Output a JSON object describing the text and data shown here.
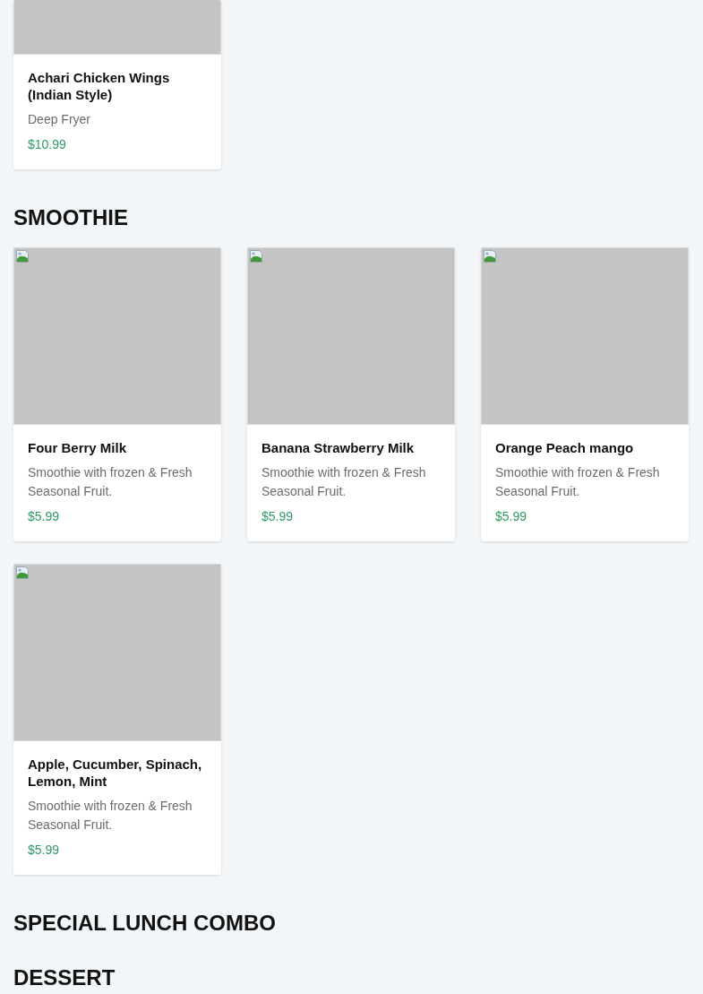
{
  "sections": [
    {
      "items": [
        {
          "name": "Achari Chicken Wings (Indian Style)",
          "description": "Deep Fryer",
          "price": "$10.99",
          "image_broken": false
        }
      ]
    },
    {
      "title": "SMOOTHIE",
      "items": [
        {
          "name": "Four Berry Milk",
          "description": "Smoothie with frozen & Fresh Seasonal Fruit.",
          "price": "$5.99",
          "image_broken": true
        },
        {
          "name": "Banana Strawberry Milk",
          "description": "Smoothie with frozen & Fresh Seasonal Fruit.",
          "price": "$5.99",
          "image_broken": true
        },
        {
          "name": "Orange Peach mango",
          "description": "Smoothie with frozen & Fresh Seasonal Fruit.",
          "price": "$5.99",
          "image_broken": true
        },
        {
          "name": "Apple, Cucumber, Spinach, Lemon, Mint",
          "description": "Smoothie with frozen & Fresh Seasonal Fruit.",
          "price": "$5.99",
          "image_broken": true
        }
      ]
    },
    {
      "title": "SPECIAL LUNCH COMBO"
    },
    {
      "title": "DESSERT"
    }
  ]
}
